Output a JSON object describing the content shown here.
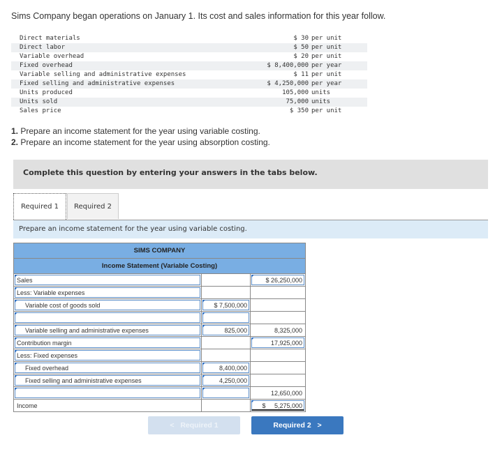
{
  "intro": "Sims Company began operations on January 1. Its cost and sales information for this year follow.",
  "cost_items": [
    {
      "label": "Direct materials",
      "value": "$ 30",
      "unit": "per unit"
    },
    {
      "label": "Direct labor",
      "value": "$ 50",
      "unit": "per unit"
    },
    {
      "label": "Variable overhead",
      "value": "$ 20",
      "unit": "per unit"
    },
    {
      "label": "Fixed overhead",
      "value": "$ 8,400,000",
      "unit": "per year"
    },
    {
      "label": "Variable selling and administrative expenses",
      "value": "$ 11",
      "unit": "per unit"
    },
    {
      "label": "Fixed selling and administrative expenses",
      "value": "$ 4,250,000",
      "unit": "per year"
    },
    {
      "label": "Units produced",
      "value": "105,000",
      "unit": "units"
    },
    {
      "label": "Units sold",
      "value": "75,000",
      "unit": "units"
    },
    {
      "label": "Sales price",
      "value": "$ 350",
      "unit": "per unit"
    }
  ],
  "requirements": [
    {
      "num": "1.",
      "text": " Prepare an income statement for the year using variable costing."
    },
    {
      "num": "2.",
      "text": " Prepare an income statement for the year using absorption costing."
    }
  ],
  "banner": "Complete this question by entering your answers in the tabs below.",
  "tabs": [
    {
      "label": "Required 1",
      "active": true
    },
    {
      "label": "Required 2",
      "active": false
    }
  ],
  "instruction": "Prepare an income statement for the year using variable costing.",
  "statement": {
    "company": "SIMS COMPANY",
    "title": "Income Statement (Variable Costing)",
    "rows": [
      {
        "label": "Sales",
        "c1": "",
        "c2": "$ 26,250,000"
      },
      {
        "label": "Less: Variable expenses",
        "c1": "",
        "c2": ""
      },
      {
        "label": "Variable cost of goods sold",
        "c1": "$ 7,500,000",
        "c2": ""
      },
      {
        "label": "",
        "c1": "",
        "c2": ""
      },
      {
        "label": "Variable selling and administrative expenses",
        "c1": "825,000",
        "c2": "8,325,000"
      },
      {
        "label": "Contribution margin",
        "c1": "",
        "c2": "17,925,000"
      },
      {
        "label": "Less: Fixed expenses",
        "c1": "",
        "c2": ""
      },
      {
        "label": "Fixed overhead",
        "c1": "8,400,000",
        "c2": ""
      },
      {
        "label": "Fixed selling and administrative expenses",
        "c1": "4,250,000",
        "c2": ""
      },
      {
        "label": "",
        "c1": "",
        "c2": "12,650,000"
      },
      {
        "label": "Income",
        "c1": "",
        "c2": "$     5,275,000"
      }
    ]
  },
  "nav": {
    "prev_label": "Required 1",
    "next_label": "Required 2",
    "prev_icon": "chevron-left-icon",
    "next_icon": "chevron-right-icon"
  },
  "colors": {
    "header_blue": "#79aee3",
    "next_button": "#3a78bf",
    "prev_button_disabled": "#d3e0ef",
    "instruction_bg": "#dcebf7"
  }
}
